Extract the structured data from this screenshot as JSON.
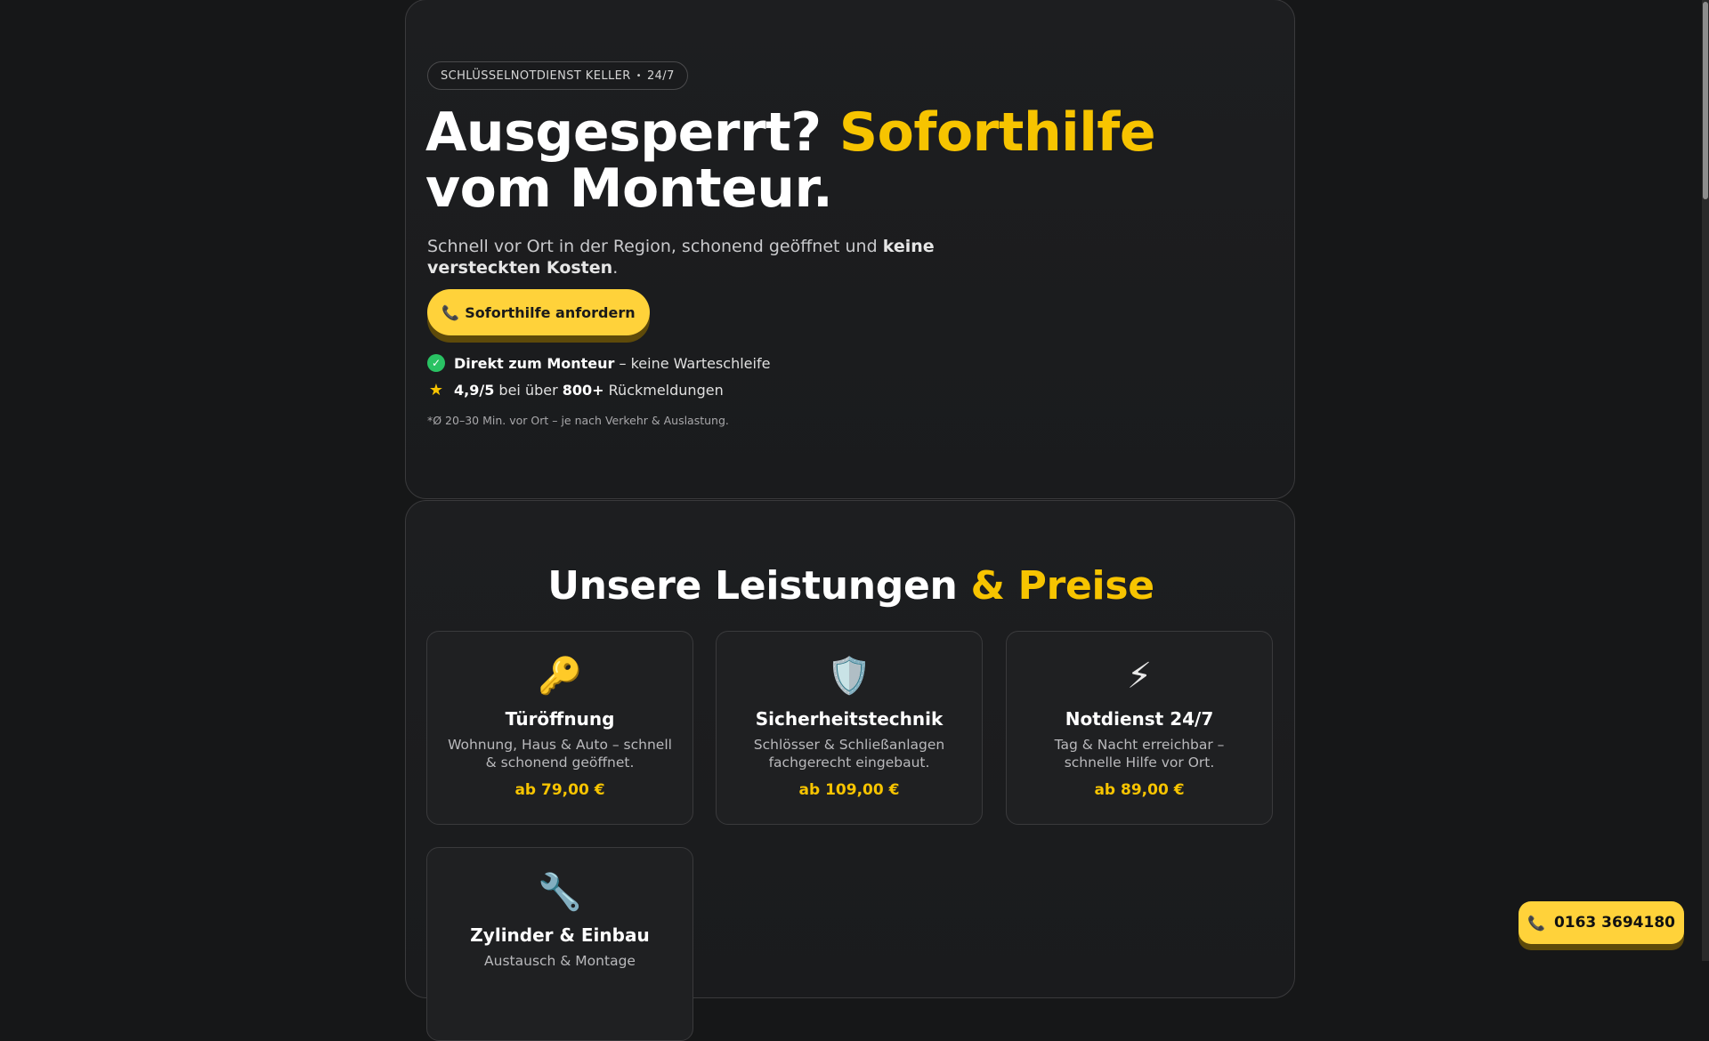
{
  "hero": {
    "badge": "SCHLÜSSELNOTDIENST KELLER",
    "badge_sep": "•",
    "badge_hours": "24/7",
    "headline_part1": "Ausgesperrt? ",
    "headline_accent": "Soforthilfe",
    "headline_part2": " vom Monteur.",
    "subtitle_plain": "Schnell vor Ort in der Region, schonend geöffnet und ",
    "subtitle_bold": "keine versteckten Kosten",
    "subtitle_end": ".",
    "cta_icon": "phone-icon",
    "cta_label": "Soforthilfe anfordern",
    "feature1_bold": "Direkt zum Monteur",
    "feature1_rest": " – keine Warteschleife",
    "feature2_rating": "4,9/5",
    "feature2_mid": " bei über ",
    "feature2_count": "800+",
    "feature2_rest": " Rückmeldungen",
    "note": "*Ø 20–30 Min. vor Ort – je nach Verkehr & Auslastung."
  },
  "services": {
    "title": "Unsere Leistungen",
    "title_accent": " & Preise",
    "items": [
      {
        "icon": "key-icon",
        "title": "Türöffnung",
        "desc": "Wohnung, Haus & Auto – schnell & schonend geöffnet.",
        "price": "ab 79,00 €"
      },
      {
        "icon": "shield-icon",
        "title": "Sicherheitstechnik",
        "desc": "Schlösser & Schließanlagen fachgerecht eingebaut.",
        "price": "ab 109,00 €"
      },
      {
        "icon": "lightning-icon",
        "title": "Notdienst 24/7",
        "desc": "Tag & Nacht erreichbar – schnelle Hilfe vor Ort.",
        "price": "ab 89,00 €"
      },
      {
        "icon": "wrench-icon",
        "title": "Zylinder & Einbau",
        "desc": "Austausch & Montage",
        "price": ""
      }
    ]
  },
  "floating": {
    "phone_icon": "phone-icon",
    "phone_number": "0163 3694180"
  },
  "colors": {
    "accent": "#f7c400",
    "button": "#ffd23a",
    "background": "#161718",
    "check": "#29c263"
  }
}
